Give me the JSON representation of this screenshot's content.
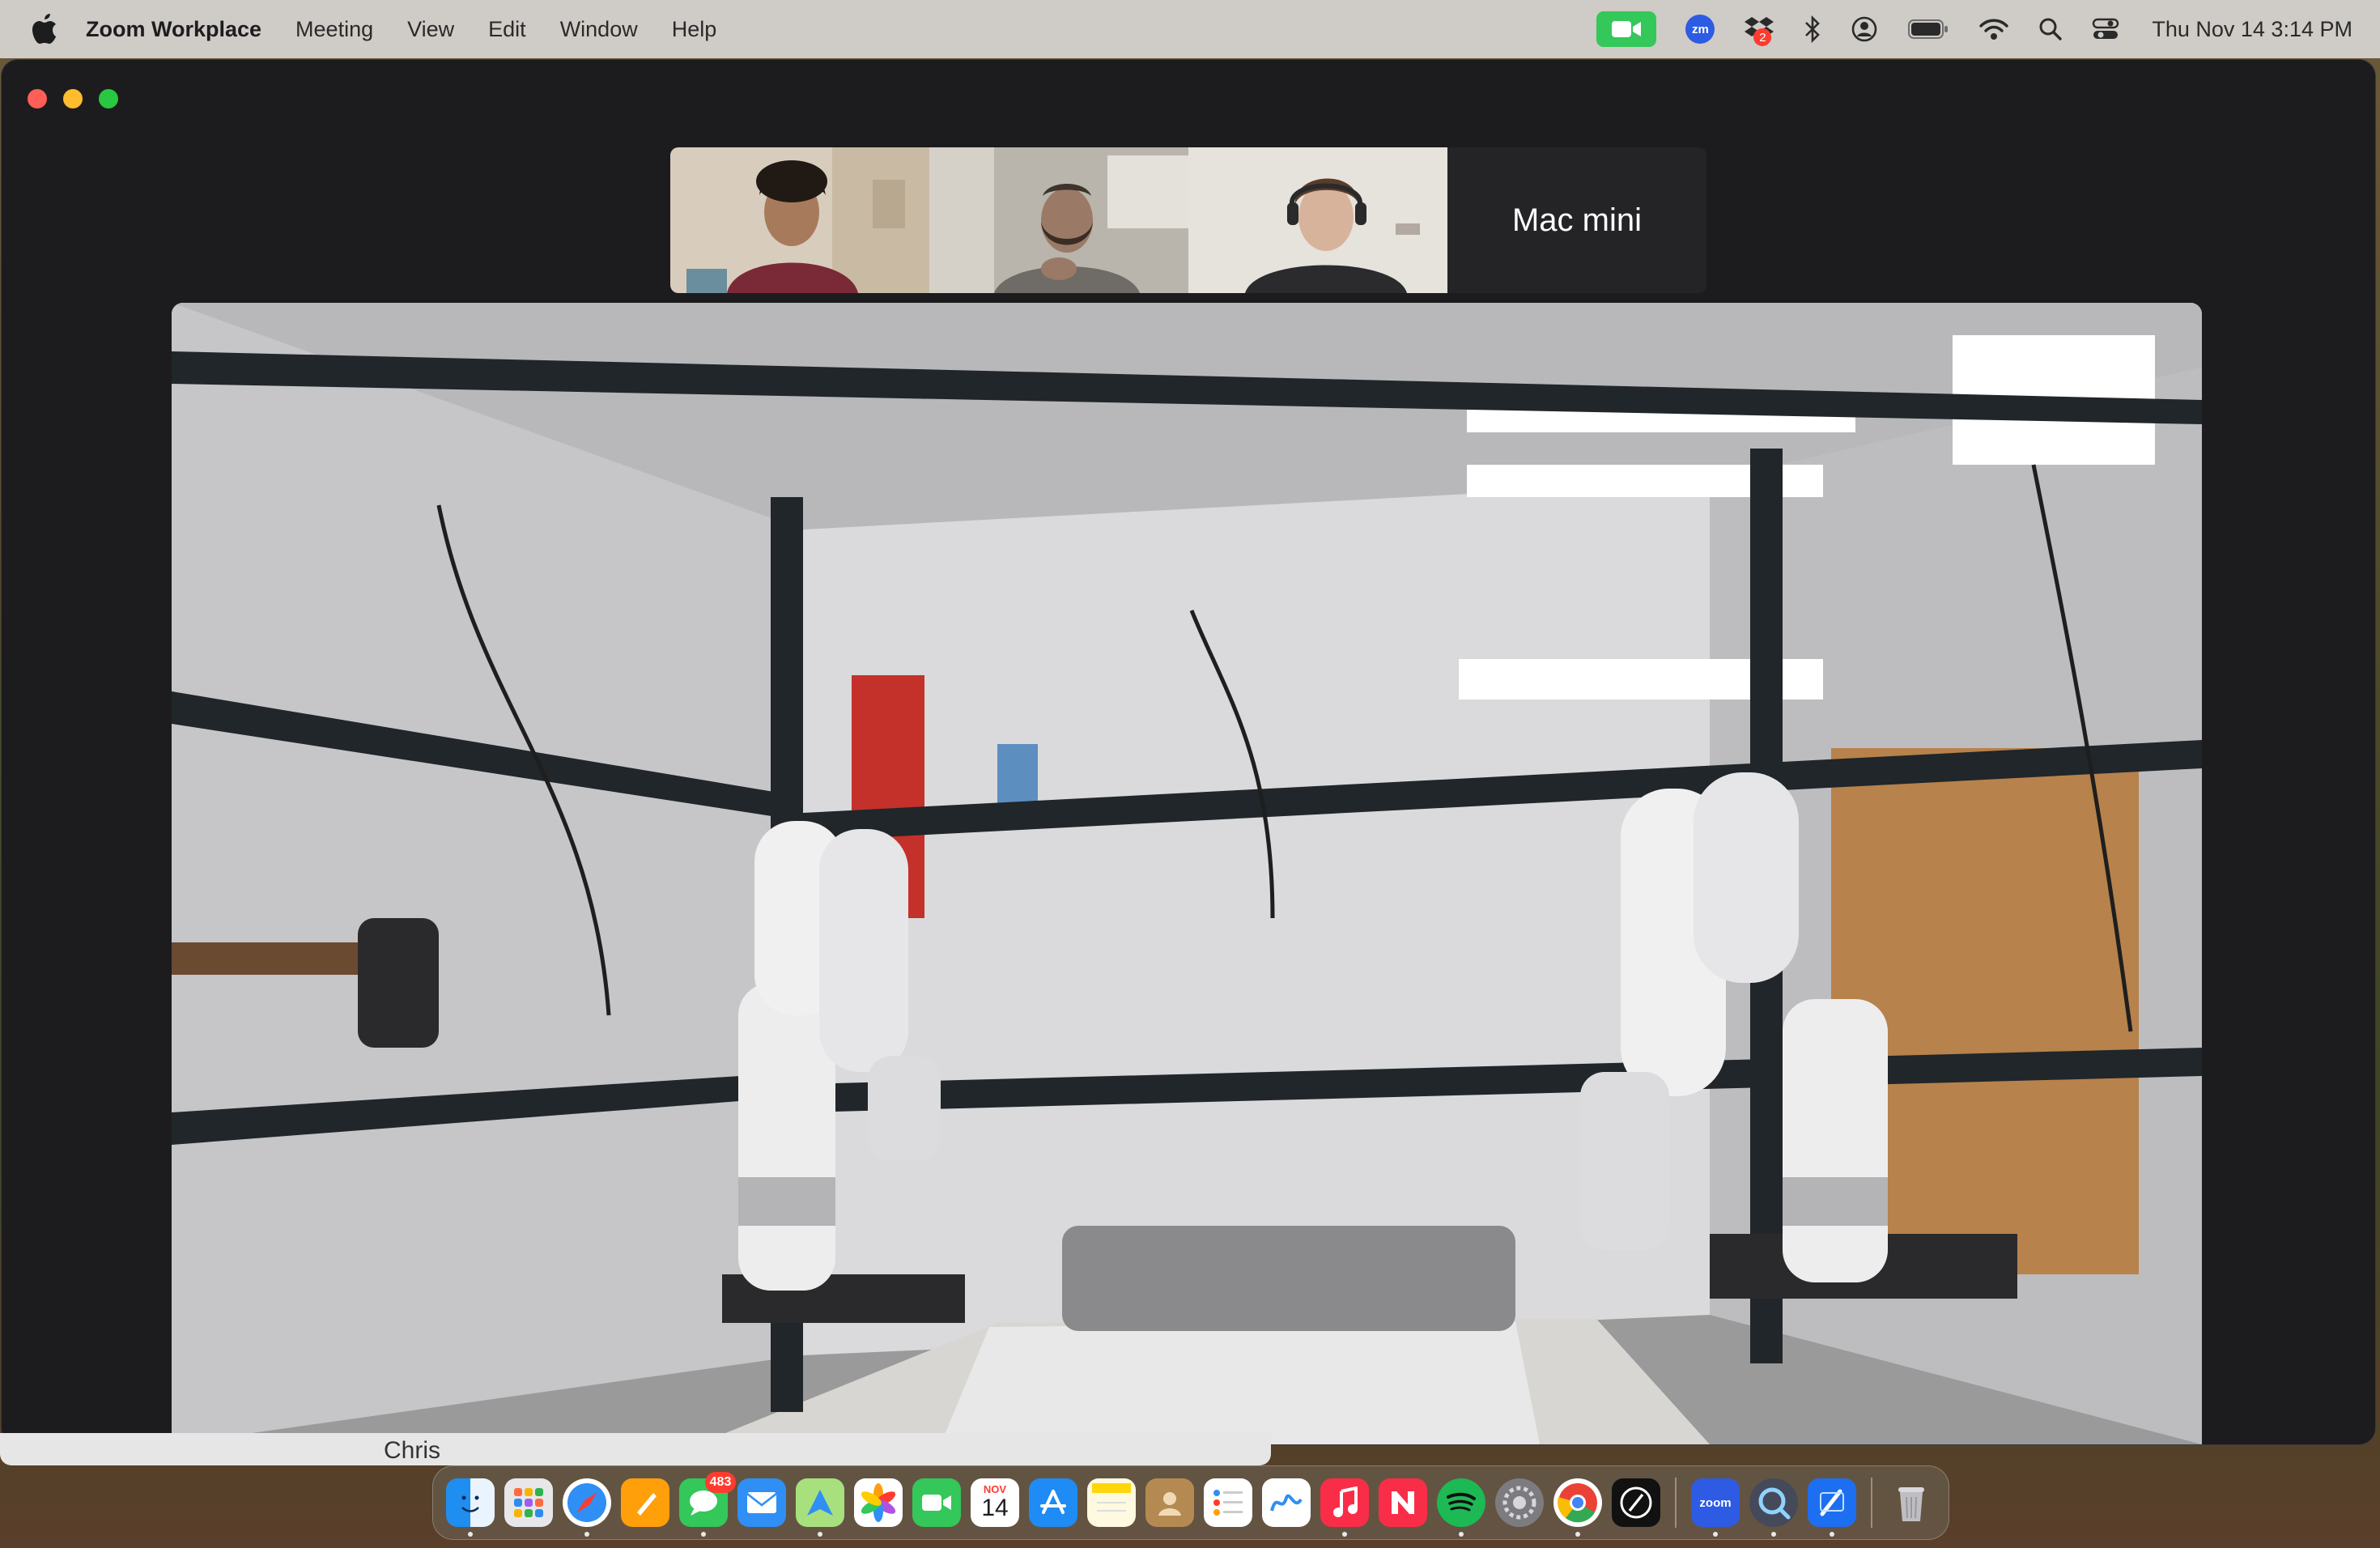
{
  "menubar": {
    "app_name": "Zoom Workplace",
    "menus": [
      "Meeting",
      "View",
      "Edit",
      "Window",
      "Help"
    ],
    "clock": "Thu Nov 14  3:14 PM",
    "status_icons": [
      "zoom-camera-icon",
      "zoom-icon",
      "dropbox-icon",
      "bluetooth-icon",
      "user-icon",
      "battery-icon",
      "wifi-icon",
      "search-icon",
      "control-center-icon"
    ],
    "dropbox_badge": "2",
    "zoom_status_label": "zm"
  },
  "meeting": {
    "participants": [
      {
        "kind": "video",
        "icon": "participant-1-video"
      },
      {
        "kind": "video",
        "icon": "participant-2-video"
      },
      {
        "kind": "video",
        "icon": "participant-3-video"
      },
      {
        "kind": "name",
        "name": "Mac mini"
      }
    ],
    "main_video_icon": "robot-lab-camera-feed"
  },
  "background_window": {
    "label": "Chris"
  },
  "dock": {
    "messages_badge": "483",
    "calendar_month": "NOV",
    "calendar_day": "14",
    "zoom_label": "zoom",
    "apps": [
      "finder-icon",
      "launchpad-icon",
      "safari-icon",
      "pages-icon",
      "messages-icon",
      "mail-icon",
      "maps-icon",
      "photos-icon",
      "facetime-icon",
      "calendar-icon",
      "app-store-icon",
      "notes-icon",
      "contacts-icon",
      "reminders-icon",
      "freeform-icon",
      "music-icon",
      "news-icon",
      "spotify-icon",
      "system-settings-icon",
      "chrome-icon",
      "perplexity-icon",
      "zoom-icon",
      "quicktime-icon",
      "xcode-icon",
      "trash-icon"
    ]
  },
  "colors": {
    "menubar_bg": "#cfcbc6",
    "window_bg": "#1c1c1e",
    "camera_green": "#34c759",
    "close_red": "#ff5f57",
    "min_yellow": "#febc2e",
    "max_green": "#28c840"
  }
}
